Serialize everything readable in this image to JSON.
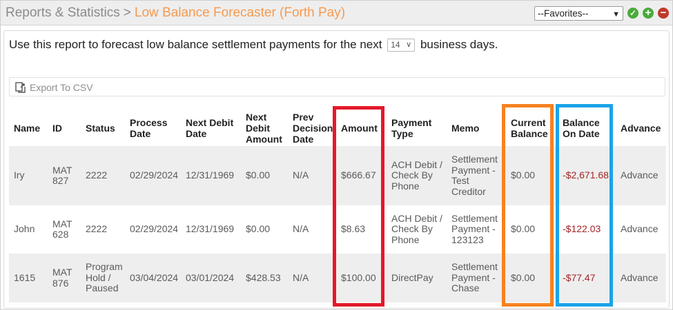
{
  "header": {
    "breadcrumb_parent": "Reports & Statistics",
    "breadcrumb_separator": ">",
    "breadcrumb_current": "Low Balance Forecaster (Forth Pay)",
    "favorites_selected": "--Favorites--",
    "action_icons": [
      "check-icon",
      "plus-icon",
      "minus-icon"
    ]
  },
  "intro": {
    "text_before": "Use this report to forecast low balance settlement payments for the next",
    "days_value": "14",
    "text_after": "business days."
  },
  "export": {
    "label": "Export To CSV",
    "icon": "export-icon"
  },
  "table": {
    "headers": [
      "Name",
      "ID",
      "Status",
      "Process Date",
      "Next Debit Date",
      "Next Debit Amount",
      "Prev Decision Date",
      "Amount",
      "Payment Type",
      "Memo",
      "Current Balance",
      "Balance On Date",
      "Advance"
    ],
    "rows": [
      [
        "Iry",
        "MAT 827",
        "2222",
        "02/29/2024",
        "12/31/1969",
        "$0.00",
        "N/A",
        "$666.67",
        "ACH Debit / Check By Phone",
        "Settlement Payment - Test Creditor",
        "$0.00",
        "-$2,671.68",
        "Advance"
      ],
      [
        "John",
        "MAT 628",
        "2222",
        "02/29/2024",
        "12/31/1969",
        "$0.00",
        "N/A",
        "$8.63",
        "ACH Debit / Check By Phone",
        "Settlement Payment - 123123",
        "$0.00",
        "-$122.03",
        "Advance"
      ],
      [
        "1615",
        "MAT 876",
        "Program Hold / Paused",
        "03/04/2024",
        "03/01/2024",
        "$428.53",
        "N/A",
        "$100.00",
        "DirectPay",
        "Settlement Payment - Chase",
        "$0.00",
        "-$77.47",
        "Advance"
      ]
    ]
  },
  "colors": {
    "breadcrumb_current": "#f59a4f",
    "negative_balance": "#a32424",
    "highlight_amount": "#e3192a",
    "highlight_current_balance": "#f7811f",
    "highlight_balance_on_date": "#1aa3e8"
  }
}
